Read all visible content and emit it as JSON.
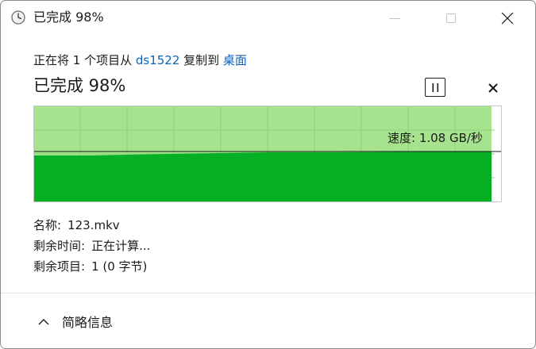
{
  "window": {
    "title": "已完成 98%",
    "controls": [
      "minimize",
      "maximize",
      "close"
    ]
  },
  "transfer": {
    "prefix": "正在将 1 个项目从 ",
    "source": "ds1522",
    "middle": " 复制到 ",
    "destination": "桌面",
    "status_title": "已完成 98%",
    "progress_percent": 98
  },
  "graph": {
    "speed_label": "速度: 1.08 GB/秒",
    "fill_color": "#06b025",
    "background_color": "#a7e38f"
  },
  "details": {
    "name_label": "名称:",
    "name_value": "123.mkv",
    "time_label": "剩余时间:",
    "time_value": "正在计算...",
    "items_label": "剩余项目:",
    "items_value": "1 (0 字节)"
  },
  "footer": {
    "toggle_label": "简略信息"
  },
  "icons": {
    "app": "clock-icon",
    "pause": "pause-icon",
    "cancel": "close-icon",
    "toggle": "chevron-up-icon"
  }
}
